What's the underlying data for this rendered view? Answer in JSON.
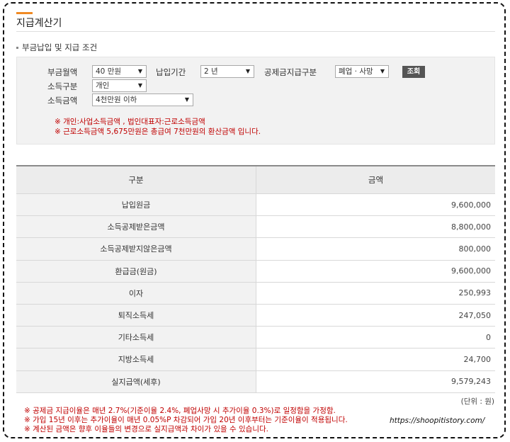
{
  "page": {
    "title": "지급계산기"
  },
  "section": {
    "title": "부금납입 및 지급 조건"
  },
  "form": {
    "monthly_label": "부금월액",
    "monthly_value": "40 만원",
    "period_label": "납입기간",
    "period_value": "2 년",
    "payout_type_label": "공제금지급구분",
    "payout_type_value": "폐업 · 사망",
    "search_button": "조회",
    "income_type_label": "소득구분",
    "income_type_value": "개인",
    "income_amount_label": "소득금액",
    "income_amount_value": "4천만원 이하"
  },
  "notes": [
    "※ 개인:사업소득금액 , 법인대표자:근로소득금액",
    "※ 근로소득금액 5,675만원은 총급여 7천만원의 환산금액 입니다."
  ],
  "table": {
    "headers": [
      "구분",
      "금액"
    ],
    "rows": [
      {
        "label": "납입원금",
        "value": "9,600,000"
      },
      {
        "label": "소득공제받은금액",
        "value": "8,800,000"
      },
      {
        "label": "소득공제받지않은금액",
        "value": "800,000"
      },
      {
        "label": "환급금(원금)",
        "value": "9,600,000"
      },
      {
        "label": "이자",
        "value": "250,993"
      },
      {
        "label": "퇴직소득세",
        "value": "247,050"
      },
      {
        "label": "기타소득세",
        "value": "0"
      },
      {
        "label": "지방소득세",
        "value": "24,700"
      },
      {
        "label": "실지급액(세후)",
        "value": "9,579,243"
      }
    ]
  },
  "unit_label": "(단위 : 원)",
  "footnotes": [
    "※ 공제금 지급이율은 매년 2.7%(기준이율 2.4%, 폐업사망 시 추가이율 0.3%)로 일정함을 가정함.",
    "※ 가입 15년 이후는 추가이율이 매년 0.05%P 차감되어 가입 20년 이후부터는 기준이율이 적용됩니다.",
    "※ 계산된 금액은 향후 이율들의 변경으로 실지급액과 차이가 있을 수 있습니다."
  ],
  "watermark": "https://shoopitistory.com/",
  "colors": {
    "accent": "#f08a24",
    "note_red": "#c00000",
    "button_bg": "#555555"
  }
}
